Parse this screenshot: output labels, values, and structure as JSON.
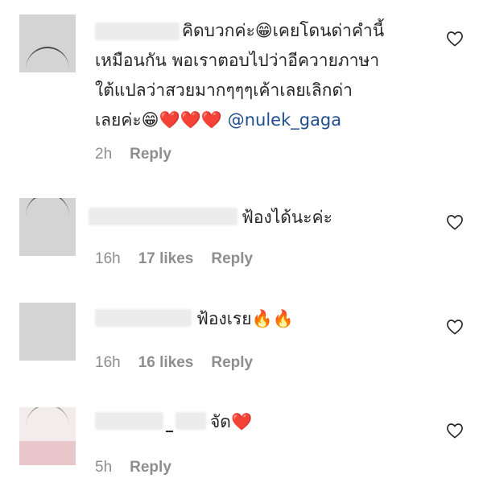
{
  "comments": [
    {
      "lines": [
        "คิดบวกค่ะ😁เคยโดนด่าคำนี้",
        "เหมือนกัน พอเราตอบไปว่าอีควายภาษา",
        "ใต้แปลว่าสวยมากๆๆๆเค้าเลยเลิกด่า",
        "เลยค่ะ😁❤️❤️❤️ "
      ],
      "mention": "@nulek_gaga",
      "time": "2h",
      "likes": "",
      "reply": "Reply"
    },
    {
      "lines": [
        "ฟ้องได้นะค่ะ"
      ],
      "mention": "",
      "time": "16h",
      "likes": "17 likes",
      "reply": "Reply"
    },
    {
      "lines": [
        "ฟ้องเรย🔥🔥"
      ],
      "mention": "",
      "time": "16h",
      "likes": "16 likes",
      "reply": "Reply"
    },
    {
      "lines": [
        "จัด❤️"
      ],
      "mention": "",
      "time": "5h",
      "likes": "",
      "reply": "Reply"
    }
  ],
  "colors": {
    "meta": "#8e8e8e",
    "mention": "#1f4e8f",
    "avatar": "#d4d4d4"
  },
  "icons": {
    "like": "heart-outline-icon"
  }
}
